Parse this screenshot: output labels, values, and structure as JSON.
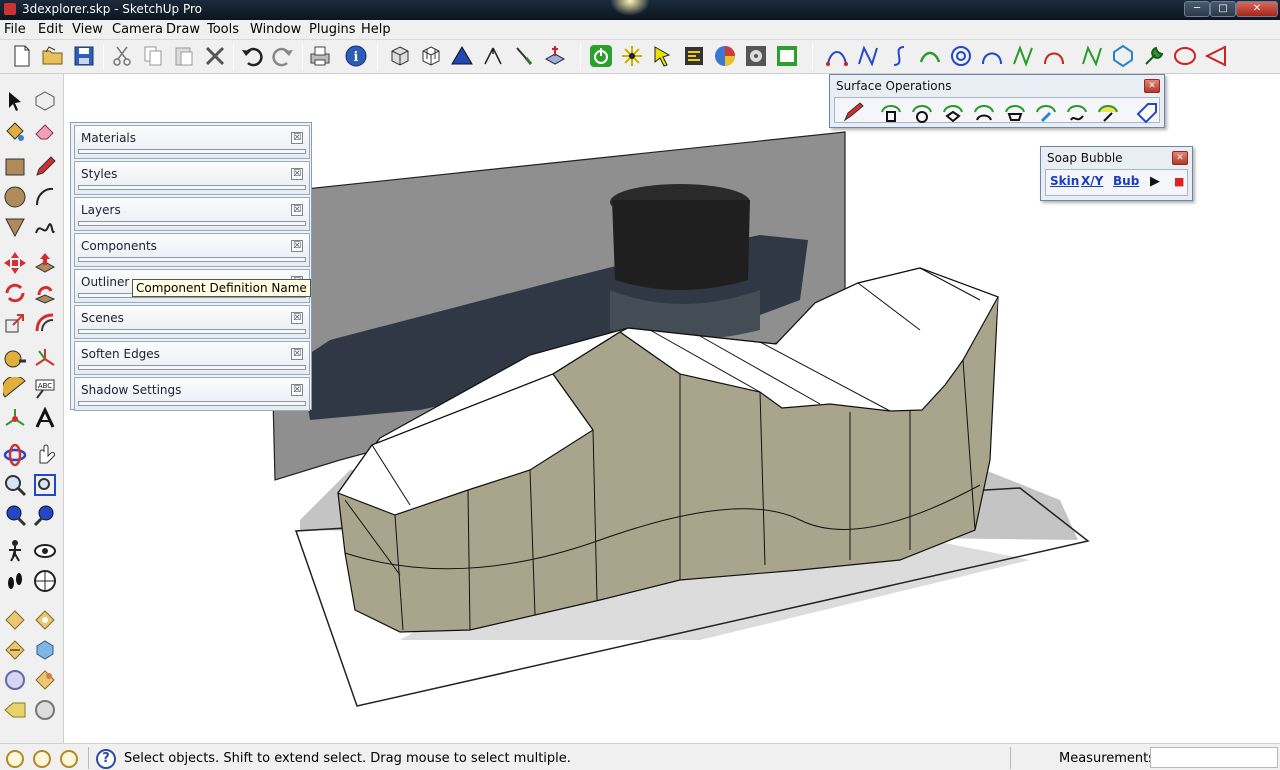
{
  "window": {
    "title": "3dexplorer.skp - SketchUp Pro",
    "minimize_glyph": "─",
    "maximize_glyph": "□",
    "close_glyph": "✕"
  },
  "menu": {
    "items": [
      "File",
      "Edit",
      "View",
      "Camera",
      "Draw",
      "Tools",
      "Window",
      "Plugins",
      "Help"
    ]
  },
  "trays": {
    "panels": [
      {
        "label": "Materials"
      },
      {
        "label": "Styles"
      },
      {
        "label": "Layers"
      },
      {
        "label": "Components"
      },
      {
        "label": "Outliner"
      },
      {
        "label": "Scenes"
      },
      {
        "label": "Soften Edges"
      },
      {
        "label": "Shadow Settings"
      }
    ],
    "close_glyph": "☒"
  },
  "tooltip": {
    "text": "Component Definition Name"
  },
  "surface_ops": {
    "title": "Surface Operations",
    "close_glyph": "✕"
  },
  "soap_bubble": {
    "title": "Soap Bubble",
    "close_glyph": "✕",
    "buttons": [
      "Skin",
      "X/Y",
      "Bub"
    ],
    "play_glyph": "▶",
    "stop_glyph": "■"
  },
  "status": {
    "help_glyph": "?",
    "message": "Select objects. Shift to extend select. Drag mouse to select multiple.",
    "measurements_label": "Measurements",
    "measurements_value": ""
  },
  "colors": {
    "title_bar": "#0c1520",
    "chrome": "#f0f0f0",
    "model_side": "#a9a58c",
    "model_top": "#ffffff",
    "backdrop": "#8f8f8f",
    "shadow": "#c4c4c4",
    "accent_blue": "#1a3cc4"
  },
  "icons": {
    "main_toolbar": [
      "new-file-icon",
      "open-file-icon",
      "save-icon",
      "cut-icon",
      "copy-icon",
      "paste-icon",
      "erase-icon",
      "undo-icon",
      "redo-icon",
      "print-icon",
      "model-info-icon",
      "iso-view-icon",
      "wireframe-view-icon",
      "triangle-icon",
      "fork-icon",
      "knife-icon",
      "mesh-icon",
      "power-icon",
      "sparkle-icon",
      "select-arrow-icon",
      "edit-icon",
      "color-wheel-icon",
      "gear-icon",
      "screenshot-icon",
      "bezier-icon",
      "curve-n-icon",
      "curve-s-icon",
      "arc-icon",
      "spiral-icon",
      "arch-icon",
      "zigzag-icon",
      "arc-red-icon",
      "curve-n2-icon",
      "polygon-icon",
      "wrench-icon",
      "ellipse-icon",
      "teardrop-icon"
    ],
    "left_tools": [
      "select-icon",
      "make-component-icon",
      "paint-bucket-icon",
      "eraser-icon",
      "rectangle-icon",
      "pencil-icon",
      "circle-icon",
      "arc-icon",
      "polygon-icon",
      "freehand-icon",
      "move-icon",
      "push-pull-icon",
      "rotate-icon",
      "follow-me-icon",
      "scale-icon",
      "offset-icon",
      "tape-measure-icon",
      "axes-icon",
      "protractor-icon",
      "text-icon",
      "position-camera-icon",
      "3d-text-icon",
      "orbit-icon",
      "pan-icon",
      "zoom-icon",
      "zoom-extents-icon",
      "previous-view-icon",
      "next-view-icon",
      "walk-icon",
      "look-around-icon",
      "footprints-icon",
      "section-plane-icon",
      "sandbox-1-icon",
      "sandbox-2-icon",
      "sandbox-3-icon",
      "sandbox-4-icon",
      "sandbox-5-icon",
      "sandbox-6-icon",
      "sandbox-7-icon",
      "sandbox-8-icon"
    ]
  }
}
